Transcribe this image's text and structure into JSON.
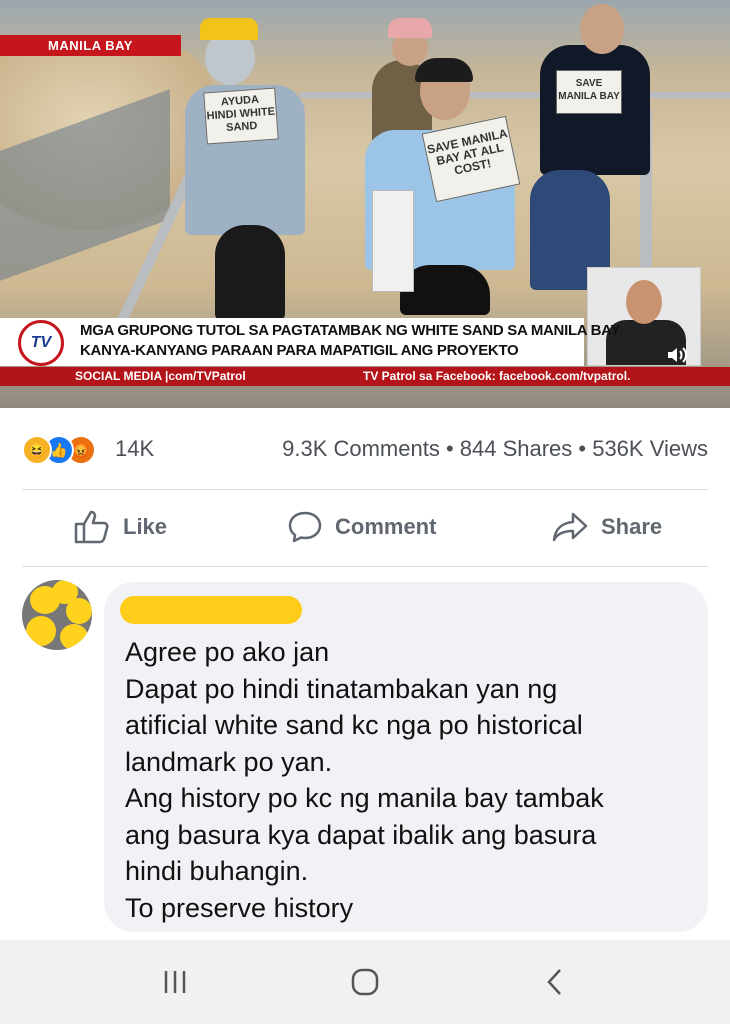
{
  "video": {
    "location_badge": "MANILA BAY",
    "signs": [
      "AYUDA HINDI WHITE SAND",
      "SAVE MANILA BAY AT ALL COST!",
      "SAVE MANILA BAY"
    ],
    "headline_line1": "MGA GRUPONG TUTOL SA PAGTATAMBAK NG WHITE SAND SA MANILA BAY",
    "headline_line2": "KANYA-KANYANG PARAAN PARA MAPATIGIL ANG PROYEKTO",
    "logo_text": "TV",
    "ticker_left": "SOCIAL MEDIA |com/TVPatrol",
    "ticker_right": "TV Patrol sa Facebook: facebook.com/tvpatrol."
  },
  "stats": {
    "reaction_icons": [
      "haha-icon",
      "like-icon",
      "angry-icon"
    ],
    "reaction_count": "14K",
    "summary": "9.3K Comments • 844 Shares • 536K Views"
  },
  "actions": {
    "like": "Like",
    "comment": "Comment",
    "share": "Share"
  },
  "comment": {
    "lines": [
      "Agree po ako jan",
      "Dapat po hindi tinatambakan yan ng",
      "atificial white sand kc nga po historical",
      "landmark po yan.",
      "Ang history po kc ng manila bay tambak",
      "ang basura kya dapat ibalik ang basura",
      "hindi buhangin.",
      "To preserve history"
    ]
  },
  "colors": {
    "broadcast_red": "#c4161c",
    "like_blue": "#1877f2",
    "redaction_yellow": "#ffcc1a",
    "bubble_gray": "#f0f2f5"
  },
  "navbar": {
    "icons": [
      "recent-apps-icon",
      "home-icon",
      "back-icon"
    ]
  }
}
